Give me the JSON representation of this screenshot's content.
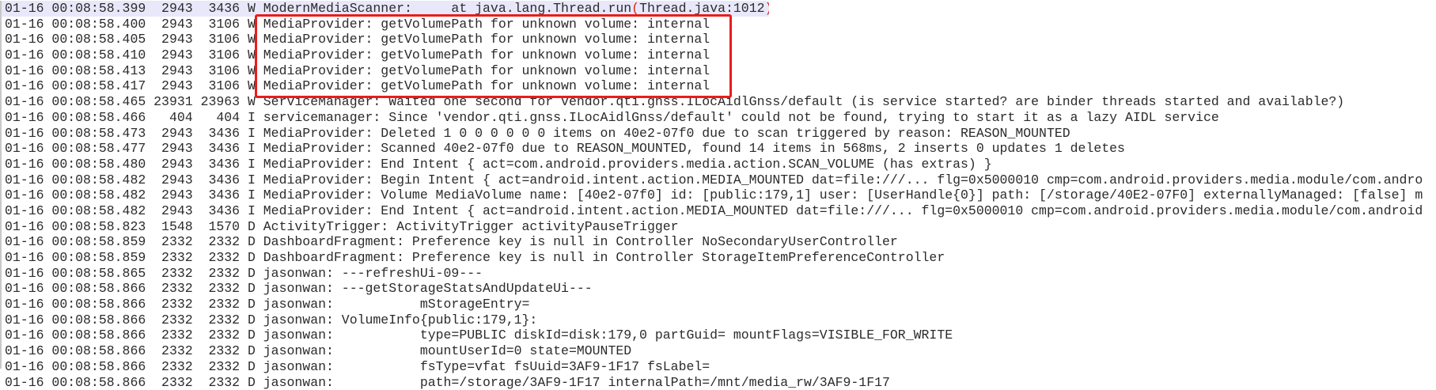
{
  "annotation": {
    "box_color": "#ea1c1c",
    "highlighted_rows": [
      1,
      2,
      3,
      4,
      5
    ]
  },
  "rows": [
    {
      "date": "01-16",
      "time": "00:08:58.399",
      "pid": "2943",
      "tid": "3436",
      "level": "W",
      "msg": "ModernMediaScanner:     at java.lang.Thread.run",
      "msg_paren_open": "(",
      "msg_paren_inner": "Thread.java:1012",
      "msg_paren_close": ")"
    },
    {
      "date": "01-16",
      "time": "00:08:58.400",
      "pid": "2943",
      "tid": "3106",
      "level": "W",
      "msg": "MediaProvider: getVolumePath for unknown volume: internal"
    },
    {
      "date": "01-16",
      "time": "00:08:58.405",
      "pid": "2943",
      "tid": "3106",
      "level": "W",
      "msg": "MediaProvider: getVolumePath for unknown volume: internal"
    },
    {
      "date": "01-16",
      "time": "00:08:58.410",
      "pid": "2943",
      "tid": "3106",
      "level": "W",
      "msg": "MediaProvider: getVolumePath for unknown volume: internal"
    },
    {
      "date": "01-16",
      "time": "00:08:58.413",
      "pid": "2943",
      "tid": "3106",
      "level": "W",
      "msg": "MediaProvider: getVolumePath for unknown volume: internal"
    },
    {
      "date": "01-16",
      "time": "00:08:58.417",
      "pid": "2943",
      "tid": "3106",
      "level": "W",
      "msg": "MediaProvider: getVolumePath for unknown volume: internal"
    },
    {
      "date": "01-16",
      "time": "00:08:58.465",
      "pid": "23931",
      "tid": "23963",
      "level": "W",
      "msg": "ServiceManager: Waited one second for vendor.qti.gnss.ILocAidlGnss/default (is service started? are binder threads started and available?)"
    },
    {
      "date": "01-16",
      "time": "00:08:58.466",
      "pid": "404",
      "tid": "404",
      "level": "I",
      "msg": "servicemanager: Since 'vendor.qti.gnss.ILocAidlGnss/default' could not be found, trying to start it as a lazy AIDL service"
    },
    {
      "date": "01-16",
      "time": "00:08:58.473",
      "pid": "2943",
      "tid": "3436",
      "level": "I",
      "msg": "MediaProvider: Deleted 1 0 0 0 0 0 0 items on 40e2-07f0 due to scan triggered by reason: REASON_MOUNTED"
    },
    {
      "date": "01-16",
      "time": "00:08:58.477",
      "pid": "2943",
      "tid": "3436",
      "level": "I",
      "msg": "MediaProvider: Scanned 40e2-07f0 due to REASON_MOUNTED, found 14 items in 568ms, 2 inserts 0 updates 1 deletes"
    },
    {
      "date": "01-16",
      "time": "00:08:58.480",
      "pid": "2943",
      "tid": "3436",
      "level": "I",
      "msg": "MediaProvider: End Intent { act=com.android.providers.media.action.SCAN_VOLUME (has extras) }"
    },
    {
      "date": "01-16",
      "time": "00:08:58.482",
      "pid": "2943",
      "tid": "3436",
      "level": "I",
      "msg": "MediaProvider: Begin Intent { act=android.intent.action.MEDIA_MOUNTED dat=file:///... flg=0x5000010 cmp=com.android.providers.media.module/com.andro"
    },
    {
      "date": "01-16",
      "time": "00:08:58.482",
      "pid": "2943",
      "tid": "3436",
      "level": "I",
      "msg": "MediaProvider: Volume MediaVolume name: [40e2-07f0] id: [public:179,1] user: [UserHandle{0}] path: [/storage/40E2-07F0] externallyManaged: [false] m"
    },
    {
      "date": "01-16",
      "time": "00:08:58.482",
      "pid": "2943",
      "tid": "3436",
      "level": "I",
      "msg": "MediaProvider: End Intent { act=android.intent.action.MEDIA_MOUNTED dat=file:///... flg=0x5000010 cmp=com.android.providers.media.module/com.android"
    },
    {
      "date": "01-16",
      "time": "00:08:58.823",
      "pid": "1548",
      "tid": "1570",
      "level": "D",
      "msg": "ActivityTrigger: ActivityTrigger activityPauseTrigger"
    },
    {
      "date": "01-16",
      "time": "00:08:58.859",
      "pid": "2332",
      "tid": "2332",
      "level": "D",
      "msg": "DashboardFragment: Preference key is null in Controller NoSecondaryUserController"
    },
    {
      "date": "01-16",
      "time": "00:08:58.859",
      "pid": "2332",
      "tid": "2332",
      "level": "D",
      "msg": "DashboardFragment: Preference key is null in Controller StorageItemPreferenceController"
    },
    {
      "date": "01-16",
      "time": "00:08:58.865",
      "pid": "2332",
      "tid": "2332",
      "level": "D",
      "msg": "jasonwan: ---refreshUi-09---"
    },
    {
      "date": "01-16",
      "time": "00:08:58.866",
      "pid": "2332",
      "tid": "2332",
      "level": "D",
      "msg": "jasonwan: ---getStorageStatsAndUpdateUi---"
    },
    {
      "date": "01-16",
      "time": "00:08:58.866",
      "pid": "2332",
      "tid": "2332",
      "level": "D",
      "msg": "jasonwan:           mStorageEntry="
    },
    {
      "date": "01-16",
      "time": "00:08:58.866",
      "pid": "2332",
      "tid": "2332",
      "level": "D",
      "msg": "jasonwan: VolumeInfo{public:179,1}:"
    },
    {
      "date": "01-16",
      "time": "00:08:58.866",
      "pid": "2332",
      "tid": "2332",
      "level": "D",
      "msg": "jasonwan:           type=PUBLIC diskId=disk:179,0 partGuid= mountFlags=VISIBLE_FOR_WRITE"
    },
    {
      "date": "01-16",
      "time": "00:08:58.866",
      "pid": "2332",
      "tid": "2332",
      "level": "D",
      "msg": "jasonwan:           mountUserId=0 state=MOUNTED"
    },
    {
      "date": "01-16",
      "time": "00:08:58.866",
      "pid": "2332",
      "tid": "2332",
      "level": "D",
      "msg": "jasonwan:           fsType=vfat fsUuid=3AF9-1F17 fsLabel="
    },
    {
      "date": "01-16",
      "time": "00:08:58.866",
      "pid": "2332",
      "tid": "2332",
      "level": "D",
      "msg": "jasonwan:           path=/storage/3AF9-1F17 internalPath=/mnt/media_rw/3AF9-1F17"
    }
  ]
}
